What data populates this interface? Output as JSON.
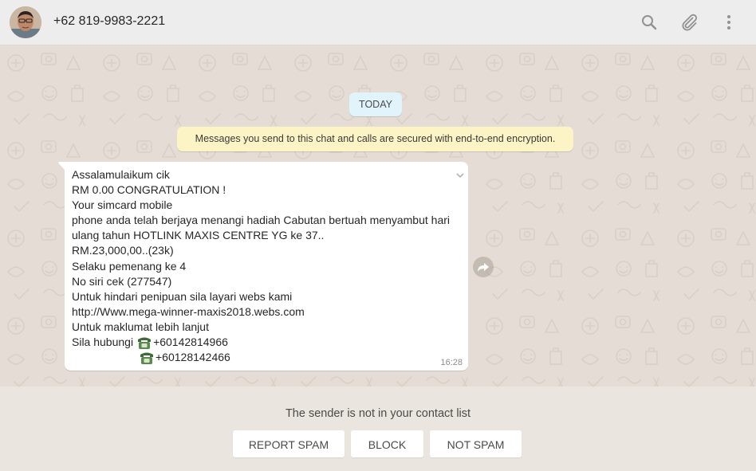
{
  "header": {
    "contact_name": "+62 819-9983-2221",
    "icons": [
      "search-icon",
      "paperclip-icon",
      "menu-dots-icon"
    ]
  },
  "chat": {
    "date_badge": "TODAY",
    "encryption_notice": "Messages you send to this chat and calls are secured with end-to-end encryption.",
    "message": {
      "lines": [
        "Assalamulaikum cik",
        "RM 0.00 CONGRATULATION !",
        "Your simcard mobile",
        "phone anda telah berjaya menangi hadiah Cabutan bertuah menyambut hari",
        "ulang tahun HOTLINK MAXIS  CENTRE YG ke 37..",
        "RM.23,000,00..(23k)",
        "Selaku pemenang ke 4",
        "No siri cek (277547)",
        "Untuk hindari penipuan sila layari webs kami",
        "http://Www.mega-winner-maxis2018.webs.com",
        "Untuk maklumat lebih lanjut"
      ],
      "contact_label": "Sila hubungi",
      "phone_1": "+60142814966",
      "phone_2": "+60128142466",
      "phone_icon": "telephone-emoji",
      "time": "16:28"
    }
  },
  "footer": {
    "sender_note": "The sender is not in your contact list",
    "report_spam_label": "REPORT SPAM",
    "block_label": "BLOCK",
    "not_spam_label": "NOT SPAM"
  },
  "colors": {
    "header_bg": "#ededed",
    "chat_bg": "#e5ddd5",
    "date_badge_bg": "#e1f3fb",
    "encryption_bg": "#fdf4c5",
    "footer_bg": "#eae6df"
  }
}
